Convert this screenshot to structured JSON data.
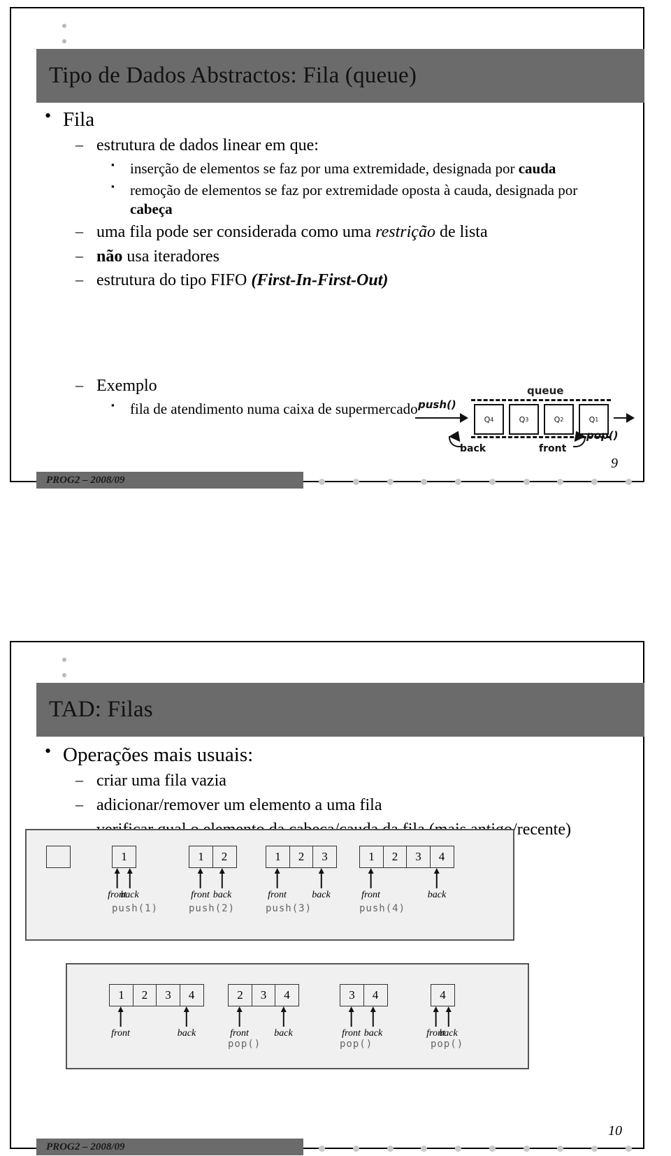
{
  "document": {
    "course_footer": "PROG2 – 2008/09"
  },
  "slides": [
    {
      "number": "9",
      "title": "Tipo de Dados Abstractos: Fila (queue)",
      "bullets": {
        "l1": "Fila",
        "l2_a": "estrutura de dados linear em que:",
        "l3_a_pre": "inserção de elementos se faz por uma extremidade, designada por ",
        "l3_a_bold": "cauda",
        "l3_b_pre": "remoção de elementos se faz por extremidade oposta à cauda, designada por",
        "l3_b_bold": "cabeça",
        "l2_b_pre": "uma fila pode ser considerada como uma ",
        "l2_b_em": "restrição",
        "l2_b_post": " de lista",
        "l2_c_bold": "não",
        "l2_c_post": " usa iteradores",
        "l2_d_pre": "estrutura do tipo FIFO ",
        "l2_d_em": "(First-In-First-Out)",
        "l2_e": "Exemplo",
        "l3_c": "fila de atendimento numa caixa de supermercado"
      },
      "figure": {
        "caption": "queue",
        "push_label": "push()",
        "pop_label": "pop()",
        "back_label": "back",
        "front_label": "front",
        "cells": [
          "Q",
          "Q",
          "Q",
          "Q"
        ],
        "subscripts": [
          "4",
          "3",
          "2",
          "1"
        ]
      }
    },
    {
      "number": "10",
      "title": "TAD: Filas",
      "bullets": {
        "l1": "Operações mais usuais:",
        "l2_a": "criar uma fila vazia",
        "l2_b": "adicionar/remover um elemento a uma fila",
        "l2_c": "verificar qual o elemento da cabeça/cauda da fila (mais antigo/recente)"
      }
    }
  ],
  "chart_data": [
    {
      "type": "table",
      "name": "push-sequence",
      "title": "",
      "steps": [
        {
          "cells": [],
          "front_index": null,
          "back_index": null,
          "op": ""
        },
        {
          "cells": [
            "1"
          ],
          "front_index": 0,
          "back_index": 0,
          "op": "push(1)"
        },
        {
          "cells": [
            "1",
            "2"
          ],
          "front_index": 0,
          "back_index": 1,
          "op": "push(2)"
        },
        {
          "cells": [
            "1",
            "2",
            "3"
          ],
          "front_index": 0,
          "back_index": 2,
          "op": "push(3)"
        },
        {
          "cells": [
            "1",
            "2",
            "3",
            "4"
          ],
          "front_index": 0,
          "back_index": 3,
          "op": "push(4)"
        }
      ],
      "front_label": "front",
      "back_label": "back"
    },
    {
      "type": "table",
      "name": "pop-sequence",
      "title": "",
      "steps": [
        {
          "cells": [
            "1",
            "2",
            "3",
            "4"
          ],
          "front_index": 0,
          "back_index": 3,
          "op": ""
        },
        {
          "cells": [
            "2",
            "3",
            "4"
          ],
          "front_index": 0,
          "back_index": 2,
          "op": "pop()"
        },
        {
          "cells": [
            "3",
            "4"
          ],
          "front_index": 0,
          "back_index": 1,
          "op": "pop()"
        },
        {
          "cells": [
            "4"
          ],
          "front_index": 0,
          "back_index": 0,
          "op": "pop()"
        }
      ],
      "front_label": "front",
      "back_label": "back"
    }
  ]
}
